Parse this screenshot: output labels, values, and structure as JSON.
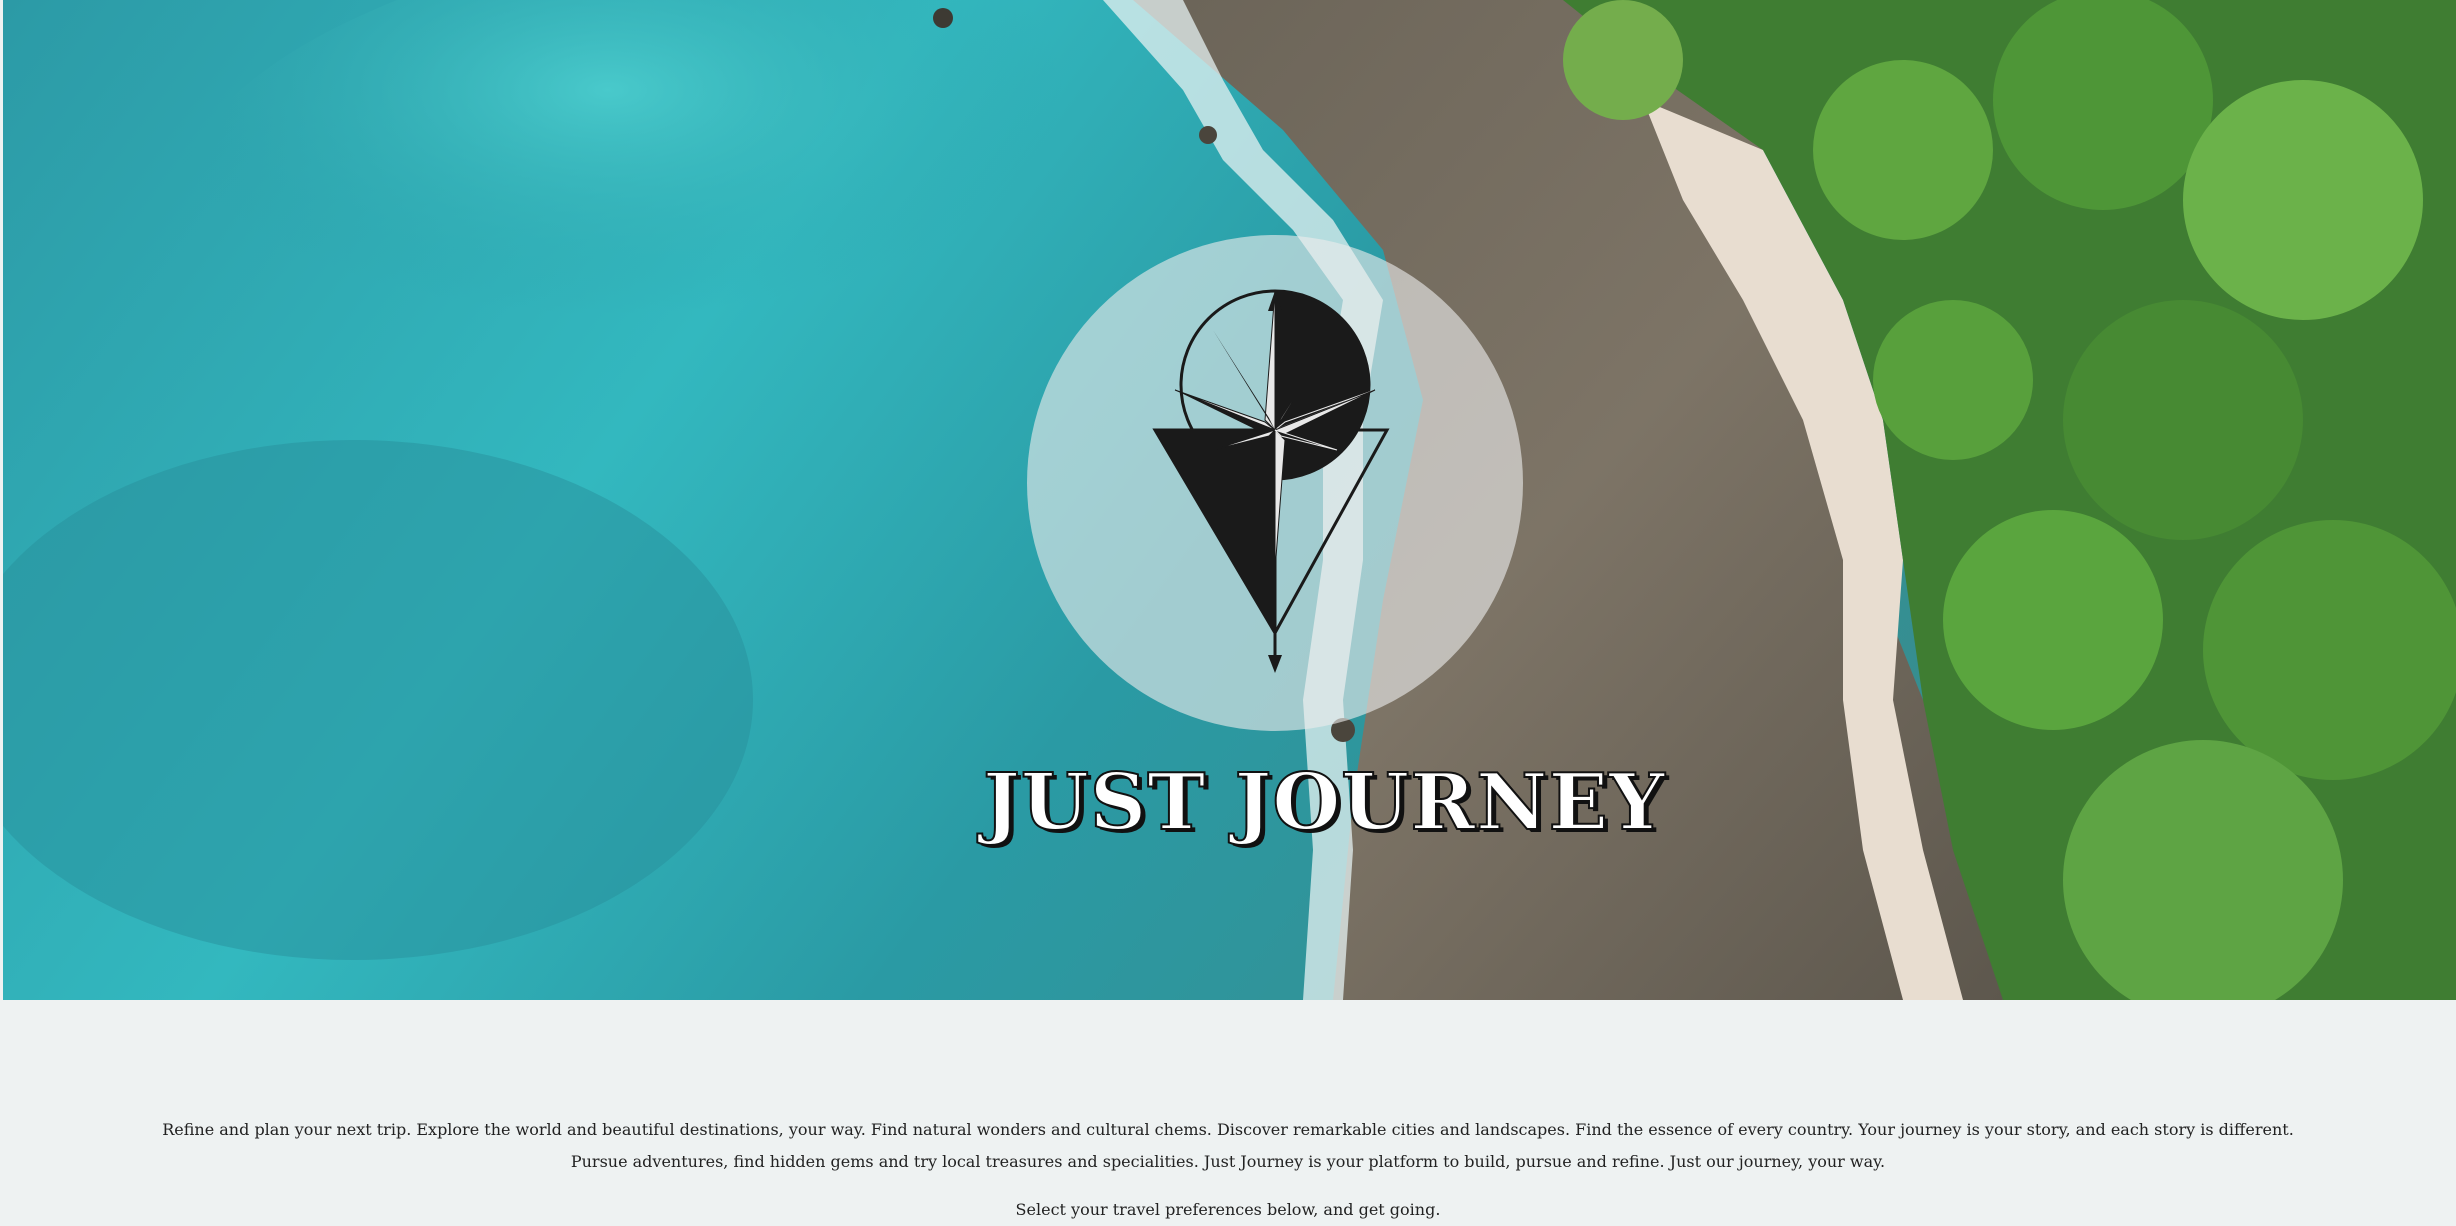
{
  "brand": {
    "title": "JUST JOURNEY",
    "logo_icon": "compass-pin-icon"
  },
  "hero": {
    "background": "aerial-coastline-image"
  },
  "intro": {
    "line1": "Refine and plan your next trip. Explore the world and beautiful destinations, your way. Find natural wonders and cultural chems. Discover remarkable cities and landscapes. Find the essence of every country. Your journey is your story, and each story is different.",
    "line2": "Pursue adventures, find hidden gems and try local treasures and specialities. Just Journey is your platform to build, pursue and refine. Just our journey, your way.",
    "cta": "Select your travel preferences below, and get going."
  },
  "colors": {
    "sea": "#2aa0a8",
    "page_background": "#eef2f2",
    "logo_ink": "#1a1a1a"
  }
}
